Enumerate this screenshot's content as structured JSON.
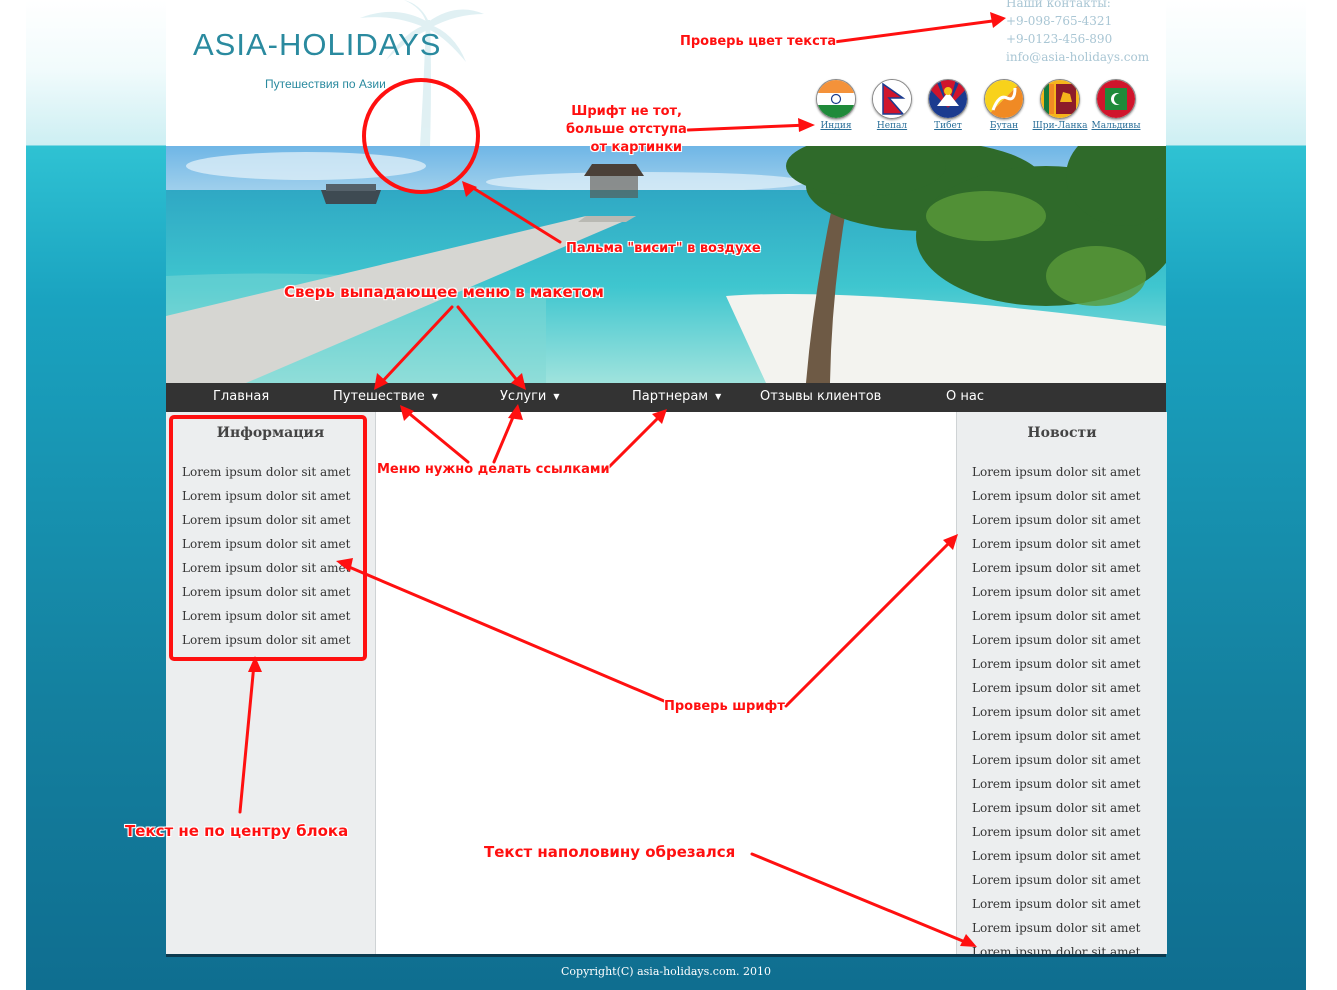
{
  "header": {
    "logo_text": "ASIA-HOLIDAYS",
    "tagline": "Путешествия по Азии",
    "contacts_title": "Наши контакты:",
    "phone_1": "+9-098-765-4321",
    "phone_2": "+9-0123-456-890",
    "email": "info@asia-holidays.com",
    "flags": [
      {
        "label": "Индия",
        "icon": "india-flag-icon"
      },
      {
        "label": "Непал",
        "icon": "nepal-flag-icon"
      },
      {
        "label": "Тибет",
        "icon": "tibet-flag-icon"
      },
      {
        "label": "Бутан",
        "icon": "bhutan-flag-icon"
      },
      {
        "label": "Шри-Ланка",
        "icon": "sri-lanka-flag-icon"
      },
      {
        "label": "Мальдивы",
        "icon": "maldives-flag-icon"
      }
    ]
  },
  "nav": {
    "items": [
      {
        "label": "Главная",
        "has_dropdown": false
      },
      {
        "label": "Путешествие",
        "has_dropdown": true
      },
      {
        "label": "Услуги",
        "has_dropdown": true
      },
      {
        "label": "Партнерам",
        "has_dropdown": true
      },
      {
        "label": "Отзывы клиентов",
        "has_dropdown": false
      },
      {
        "label": "О нас",
        "has_dropdown": false
      }
    ],
    "caret": "▼"
  },
  "left_block": {
    "title": "Информация",
    "items": [
      "Lorem ipsum dolor sit amet",
      "Lorem ipsum dolor sit amet",
      "Lorem ipsum dolor sit amet",
      "Lorem ipsum dolor sit amet",
      "Lorem ipsum dolor sit amet",
      "Lorem ipsum dolor sit amet",
      "Lorem ipsum dolor sit amet",
      "Lorem ipsum dolor sit amet"
    ]
  },
  "right_block": {
    "title": "Новости",
    "items": [
      "Lorem ipsum dolor sit amet",
      "Lorem ipsum dolor sit amet",
      "Lorem ipsum dolor sit amet",
      "Lorem ipsum dolor sit amet",
      "Lorem ipsum dolor sit amet",
      "Lorem ipsum dolor sit amet",
      "Lorem ipsum dolor sit amet",
      "Lorem ipsum dolor sit amet",
      "Lorem ipsum dolor sit amet",
      "Lorem ipsum dolor sit amet",
      "Lorem ipsum dolor sit amet",
      "Lorem ipsum dolor sit amet",
      "Lorem ipsum dolor sit amet",
      "Lorem ipsum dolor sit amet",
      "Lorem ipsum dolor sit amet",
      "Lorem ipsum dolor sit amet",
      "Lorem ipsum dolor sit amet",
      "Lorem ipsum dolor sit amet",
      "Lorem ipsum dolor sit amet",
      "Lorem ipsum dolor sit amet",
      "Lorem ipsum dolor sit amet"
    ]
  },
  "footer": {
    "copyright": "Copyright(C) asia-holidays.com. 2010"
  },
  "annotations": {
    "check_text_color": "Проверь цвет текста",
    "font_wrong_line1": "Шрифт не тот,",
    "font_wrong_line2": "больше отступа",
    "font_wrong_line3": "от картинки",
    "palm_hanging": "Пальма \"висит\" в воздухе",
    "check_dropdown": "Сверь выпадающее меню в макетом",
    "menu_links": "Меню нужно делать ссылками",
    "check_font": "Проверь шрифт",
    "text_not_centered": "Текст не по центру блока",
    "text_cut_off": "Текст наполовину обрезался"
  },
  "colors": {
    "accent_red": "#ff1010",
    "logo_teal": "#2a8a9f",
    "nav_bg": "#333333",
    "sidebar_bg": "#eceeef"
  }
}
